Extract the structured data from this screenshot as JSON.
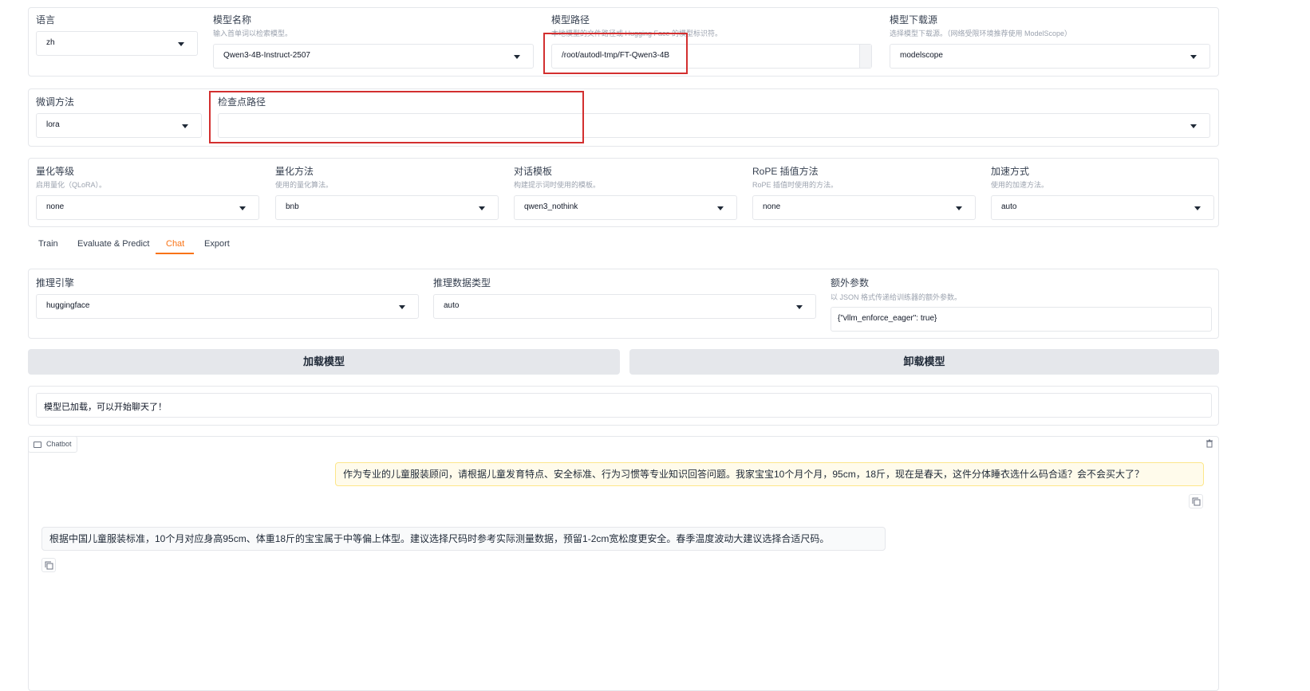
{
  "top_row": {
    "language": {
      "label": "语言",
      "value": "zh"
    },
    "model_name": {
      "label": "模型名称",
      "hint": "输入首单词以检索模型。",
      "value": "Qwen3-4B-Instruct-2507"
    },
    "model_path": {
      "label": "模型路径",
      "hint": "本地模型的文件路径或 Hugging Face 的模型标识符。",
      "value": "/root/autodl-tmp/FT-Qwen3-4B"
    },
    "model_source": {
      "label": "模型下载源",
      "hint": "选择模型下载源。（网络受限环境推荐使用 ModelScope）",
      "value": "modelscope"
    }
  },
  "second_row": {
    "finetune_method": {
      "label": "微调方法",
      "value": "lora"
    },
    "checkpoint_path": {
      "label": "检查点路径",
      "value": ""
    }
  },
  "third_row": {
    "quant_level": {
      "label": "量化等级",
      "hint": "启用量化（QLoRA）。",
      "value": "none"
    },
    "quant_method": {
      "label": "量化方法",
      "hint": "使用的量化算法。",
      "value": "bnb"
    },
    "template": {
      "label": "对话模板",
      "hint": "构建提示词时使用的模板。",
      "value": "qwen3_nothink"
    },
    "rope": {
      "label": "RoPE 插值方法",
      "hint": "RoPE 插值时使用的方法。",
      "value": "none"
    },
    "booster": {
      "label": "加速方式",
      "hint": "使用的加速方法。",
      "value": "auto"
    }
  },
  "tabs": [
    "Train",
    "Evaluate & Predict",
    "Chat",
    "Export"
  ],
  "chat_settings": {
    "infer_backend": {
      "label": "推理引擎",
      "value": "huggingface"
    },
    "infer_dtype": {
      "label": "推理数据类型",
      "value": "auto"
    },
    "extra_args": {
      "label": "额外参数",
      "hint": "以 JSON 格式传递给训练器的额外参数。",
      "value": "{\"vllm_enforce_eager\": true}"
    }
  },
  "buttons": {
    "load": "加载模型",
    "unload": "卸载模型"
  },
  "status_text": "模型已加载，可以开始聊天了！",
  "chatbot": {
    "label": "Chatbot",
    "messages": [
      {
        "role": "user",
        "text": "作为专业的儿童服装顾问，请根据儿童发育特点、安全标准、行为习惯等专业知识回答问题。我家宝宝10个月个月，95cm，18斤，现在是春天，这件分体睡衣选什么码合适？会不会买大了？"
      },
      {
        "role": "assistant",
        "text": "根据中国儿童服装标准，10个月对应身高95cm、体重18斤的宝宝属于中等偏上体型。建议选择尺码时参考实际测量数据，预留1-2cm宽松度更安全。春季温度波动大建议选择合适尺码。"
      }
    ]
  },
  "colors": {
    "accent": "#f97316",
    "highlight_box": "#d32f2f"
  }
}
